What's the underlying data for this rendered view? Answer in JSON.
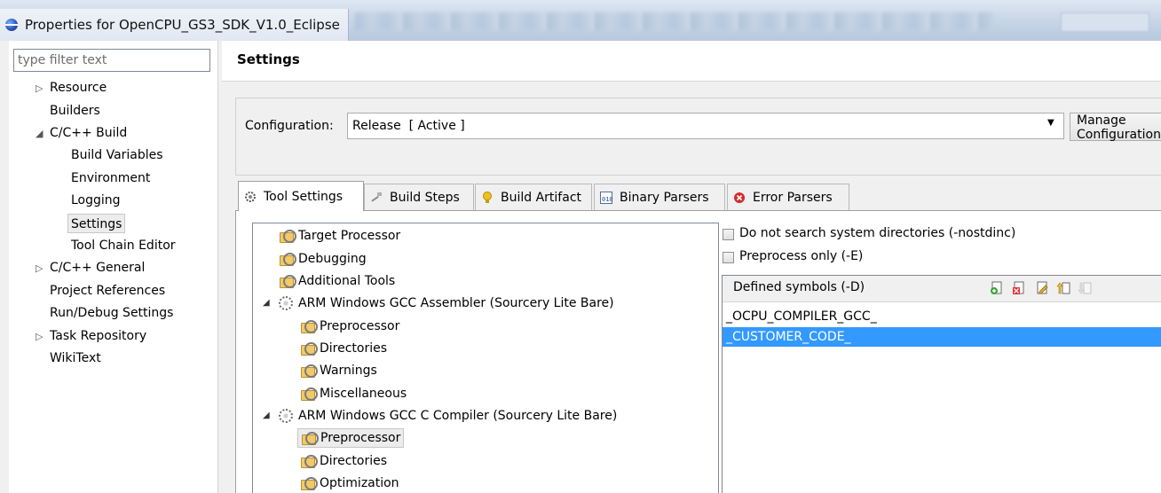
{
  "window": {
    "title": "Properties for OpenCPU_GS3_SDK_V1.0_Eclipse"
  },
  "filter": {
    "placeholder": "type filter text"
  },
  "nav": {
    "resource": "Resource",
    "builders": "Builders",
    "cpp_build": "C/C++ Build",
    "build_variables": "Build Variables",
    "environment": "Environment",
    "logging": "Logging",
    "settings": "Settings",
    "tool_chain_editor": "Tool Chain Editor",
    "cpp_general": "C/C++ General",
    "project_references": "Project References",
    "run_debug_settings": "Run/Debug Settings",
    "task_repository": "Task Repository",
    "wikitext": "WikiText"
  },
  "page": {
    "title": "Settings"
  },
  "configuration": {
    "label": "Configuration:",
    "value": "Release  [ Active ]",
    "manage_label": "Manage Configurations..."
  },
  "tabs": {
    "tool_settings": "Tool Settings",
    "build_steps": "Build Steps",
    "build_artifact": "Build Artifact",
    "binary_parsers": "Binary Parsers",
    "error_parsers": "Error Parsers"
  },
  "tool_tree": {
    "target_processor": "Target Processor",
    "debugging": "Debugging",
    "additional_tools": "Additional Tools",
    "assembler": "ARM Windows GCC Assembler (Sourcery Lite Bare)",
    "asm_preprocessor": "Preprocessor",
    "asm_directories": "Directories",
    "asm_warnings": "Warnings",
    "asm_misc": "Miscellaneous",
    "c_compiler": "ARM Windows GCC C Compiler (Sourcery Lite Bare)",
    "c_preprocessor": "Preprocessor",
    "c_directories": "Directories",
    "c_optimization": "Optimization"
  },
  "options": {
    "nostdinc": "Do not search system directories (-nostdinc)",
    "preprocess_only": "Preprocess only (-E)"
  },
  "symbols": {
    "title": "Defined symbols (-D)",
    "items": [
      "_OCPU_COMPILER_GCC_",
      "_CUSTOMER_CODE_"
    ]
  },
  "colors": {
    "selection": "#3399ff",
    "window_bg": "#f0f0f0"
  }
}
